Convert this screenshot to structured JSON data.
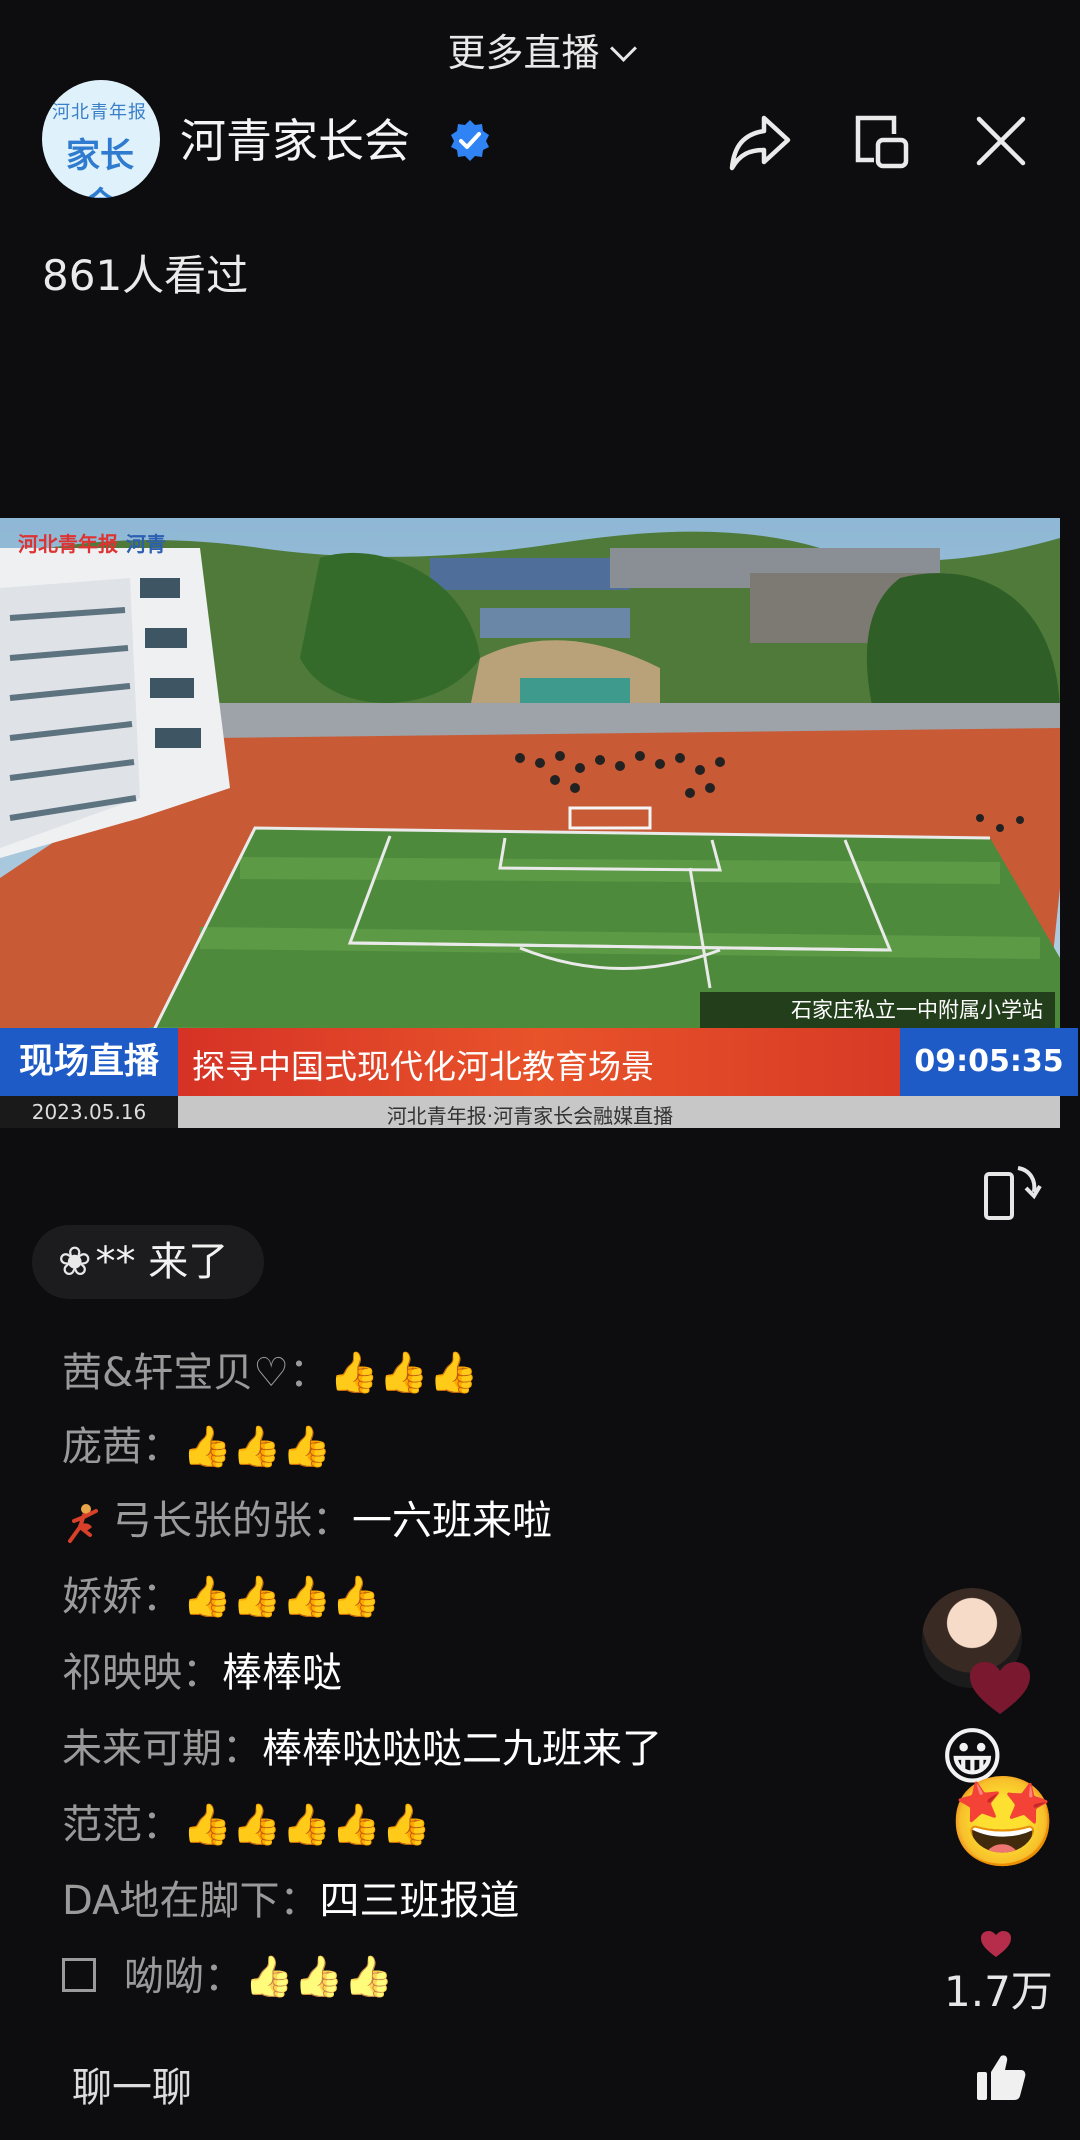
{
  "header": {
    "more_live_label": "更多直播",
    "channel_name": "河青家长会",
    "avatar_text_top": "河北青年报",
    "avatar_text_main": "家长会",
    "viewers_text": "861人看过"
  },
  "video": {
    "watermark_left": "河北青年报",
    "watermark_right": "河青",
    "location": "石家庄私立一中附属小学站",
    "live_badge": "现场直播",
    "live_title": "探寻中国式现代化河北教育场景",
    "clock": "09:05:35",
    "date": "2023.05.16",
    "credit": "河北青年报·河青家长会融媒直播"
  },
  "chat": {
    "join_user": "**",
    "join_text": "来了",
    "messages": [
      {
        "user": "茜&轩宝贝♡：",
        "text": "",
        "thumbs": "👍👍👍",
        "thumb_style": "dark"
      },
      {
        "user": "庞茜：",
        "text": "",
        "thumbs": "👍👍👍",
        "thumb_style": "dark"
      },
      {
        "user": "弓长张的张：",
        "text": "一六班来啦",
        "thumbs": "",
        "badge": "dancer"
      },
      {
        "user": "娇娇：",
        "text": "",
        "thumbs": "👍👍👍👍",
        "thumb_style": "dark"
      },
      {
        "user": "祁映映：",
        "text": "棒棒哒",
        "thumbs": ""
      },
      {
        "user": "未来可期：",
        "text": "棒棒哒哒哒二九班来了",
        "thumbs": ""
      },
      {
        "user": "范范：",
        "text": "",
        "thumbs": "👍👍👍👍👍",
        "thumb_style": "dark"
      },
      {
        "user": "DA地在脚下：",
        "text": "四三班报道",
        "thumbs": ""
      },
      {
        "user": "呦呦：",
        "text": "",
        "thumbs": "👍👍👍",
        "thumb_style": "light",
        "checkbox": true
      }
    ]
  },
  "side": {
    "like_count": "1.7万"
  },
  "footer": {
    "chat_placeholder": "聊一聊"
  },
  "colors": {
    "background": "#0d0d0f",
    "live_blue": "#1e5bc6",
    "title_red": "#d63226",
    "verified_blue": "#2f83f5"
  }
}
